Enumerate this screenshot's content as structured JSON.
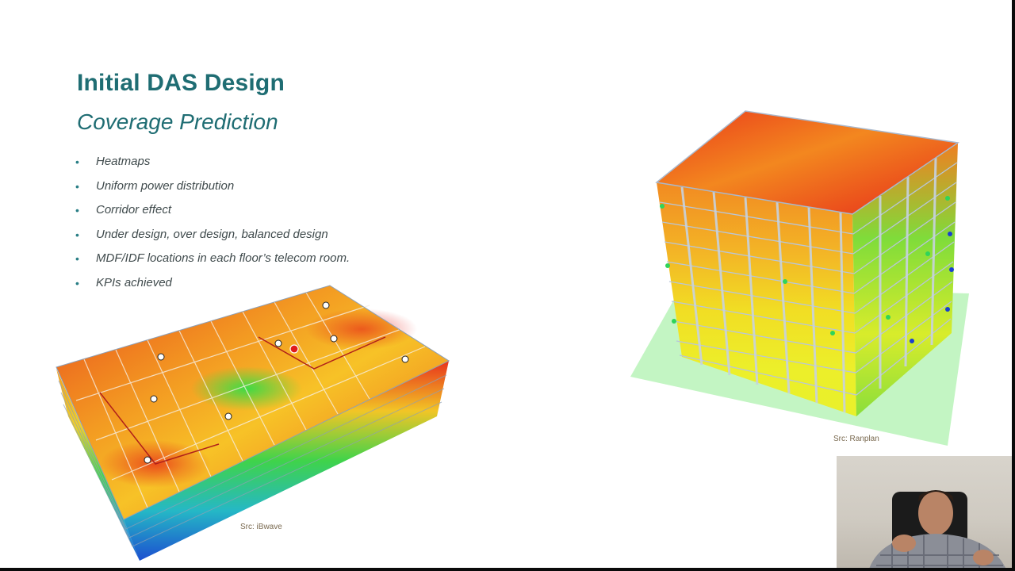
{
  "slide": {
    "title": "Initial DAS Design",
    "subtitle": "Coverage Prediction",
    "bullet_marker": "•",
    "bullets": [
      "Heatmaps",
      "Uniform power distribution",
      "Corridor effect",
      "Under design, over design, balanced design",
      "MDF/IDF locations in each floor’s telecom room.",
      "KPIs achieved"
    ]
  },
  "images": {
    "left_source": "Src: iBwave",
    "right_source": "Src: Ranplan"
  },
  "colors": {
    "title": "#1f6d73",
    "bullet_text": "#3f4a4c",
    "heat_red": "#e8231c",
    "heat_orange": "#f59a1e",
    "heat_yellow": "#f4e81a",
    "heat_green": "#35d64a",
    "heat_blue": "#1f5fd6"
  }
}
